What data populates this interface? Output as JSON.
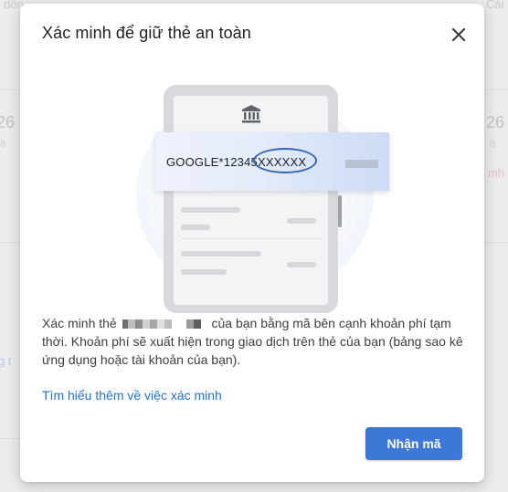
{
  "background": {
    "tab_left": "dôn",
    "tab_right": "Cài",
    "number_left": "26",
    "number_left_sub": "8",
    "number_right": "26",
    "number_right_sub": "8",
    "link_left": "g t",
    "link_right": "mh"
  },
  "dialog": {
    "title": "Xác minh để giữ thẻ an toàn",
    "close_icon": "close-icon",
    "illustration": {
      "bank_icon": "bank-icon",
      "card_prefix": "GOOGLE*12345",
      "card_code": "XXXXXX"
    },
    "body_before": "Xác minh thẻ",
    "body_after": "của bạn bằng mã bên cạnh khoản phí tạm thời. Khoản phí sẽ xuất hiện trong giao dịch trên thẻ của bạn (bảng sao kê ứng dụng hoặc tài khoản của bạn).",
    "learn_more": "Tìm hiểu thêm về việc xác minh",
    "primary_button": "Nhận mã"
  },
  "colors": {
    "primary": "#3c78d8",
    "link": "#1a73e8",
    "circle": "#3564b9"
  }
}
